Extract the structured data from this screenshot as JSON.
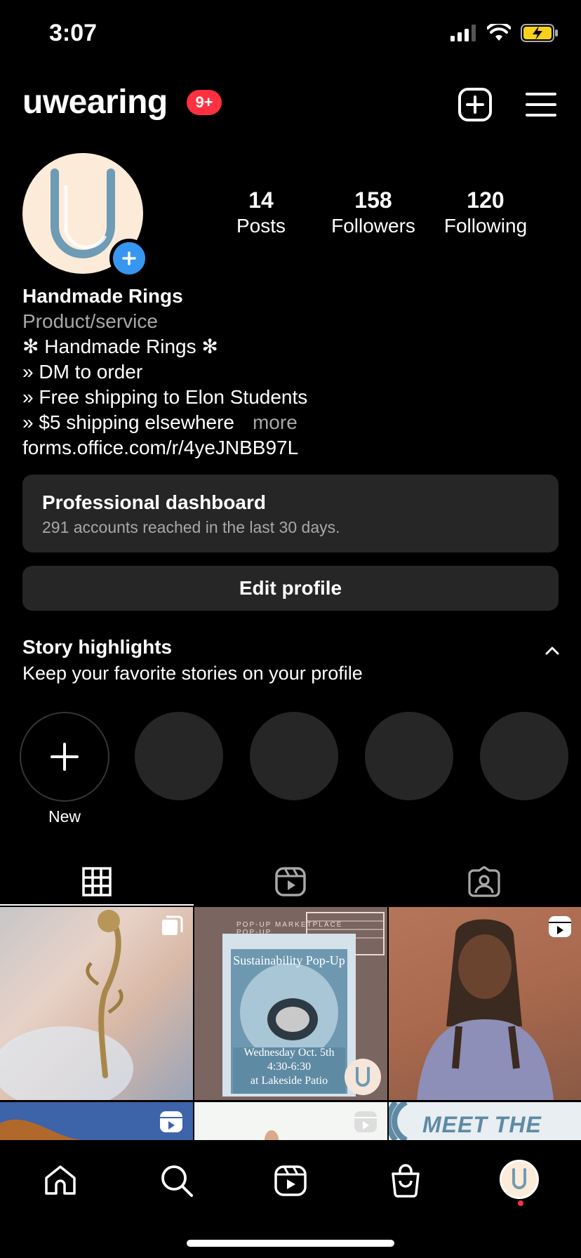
{
  "status_bar": {
    "time": "3:07"
  },
  "header": {
    "username": "uwearing",
    "notification_badge": "9+"
  },
  "profile": {
    "stats": [
      {
        "value": "14",
        "label": "Posts"
      },
      {
        "value": "158",
        "label": "Followers"
      },
      {
        "value": "120",
        "label": "Following"
      }
    ],
    "name": "Handmade Rings",
    "category": "Product/service",
    "bio_lines": [
      "✻ Handmade Rings ✻",
      "» DM to order",
      "» Free shipping to Elon Students",
      "» $5 shipping elsewhere"
    ],
    "more_label": "more",
    "link": "forms.office.com/r/4yeJNBB97L"
  },
  "dashboard": {
    "title": "Professional dashboard",
    "subtitle": "291 accounts reached in the last 30 days."
  },
  "edit_profile_label": "Edit profile",
  "story_highlights": {
    "title": "Story highlights",
    "subtitle": "Keep your favorite stories on your profile",
    "new_label": "New"
  },
  "posts": {
    "post2": {
      "arc_text": "POP-UP MARKETPLACE POP-UP",
      "title": "Sustainability Pop-Up",
      "date": "Wednesday Oct. 5th",
      "time": "4:30-6:30",
      "place": "at Lakeside Patio"
    },
    "post6": {
      "text": "MEET THE CEO"
    }
  },
  "colors": {
    "accent_blue": "#3797f0",
    "badge_red": "#ff3040",
    "surface": "#262626",
    "muted": "#a8a8a8"
  }
}
